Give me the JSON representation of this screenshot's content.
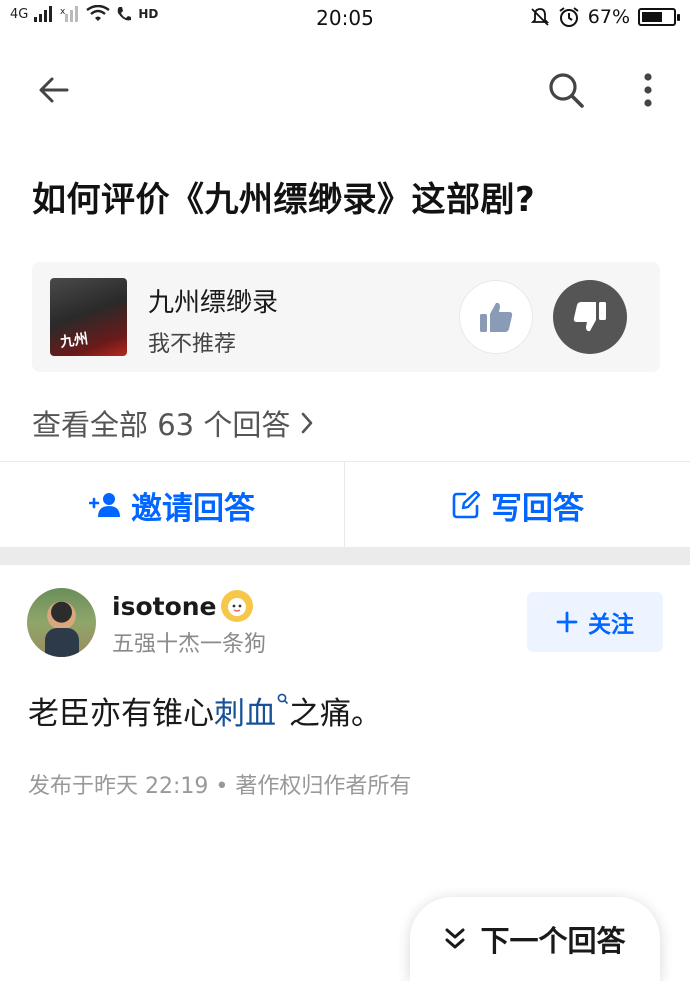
{
  "status_bar": {
    "signal_left": "4G",
    "signal_right": "HD",
    "time": "20:05",
    "battery_text": "67%",
    "battery_level": 0.67
  },
  "nav": {
    "back_icon": "arrow-left-icon",
    "search_icon": "search-icon",
    "more_icon": "more-vertical-icon"
  },
  "question": {
    "title": "如何评价《九州缥缈录》这部剧?"
  },
  "drama_card": {
    "name": "九州缥缈录",
    "status": "我不推荐",
    "poster_text": "九州"
  },
  "view_all": {
    "label": "查看全部 63 个回答"
  },
  "actions": {
    "invite_label": "邀请回答",
    "write_label": "写回答"
  },
  "answer": {
    "author_name": "isotone",
    "author_bio": "五强十杰一条狗",
    "follow_label": "关注",
    "text_before": "老臣亦有锥心",
    "text_link": "刺血",
    "text_after": "之痛。",
    "meta": "发布于昨天 22:19 • 著作权归作者所有"
  },
  "next_answer": {
    "label": "下一个回答"
  },
  "colors": {
    "accent": "#0066ff",
    "link": "#175199",
    "muted": "#999999"
  }
}
